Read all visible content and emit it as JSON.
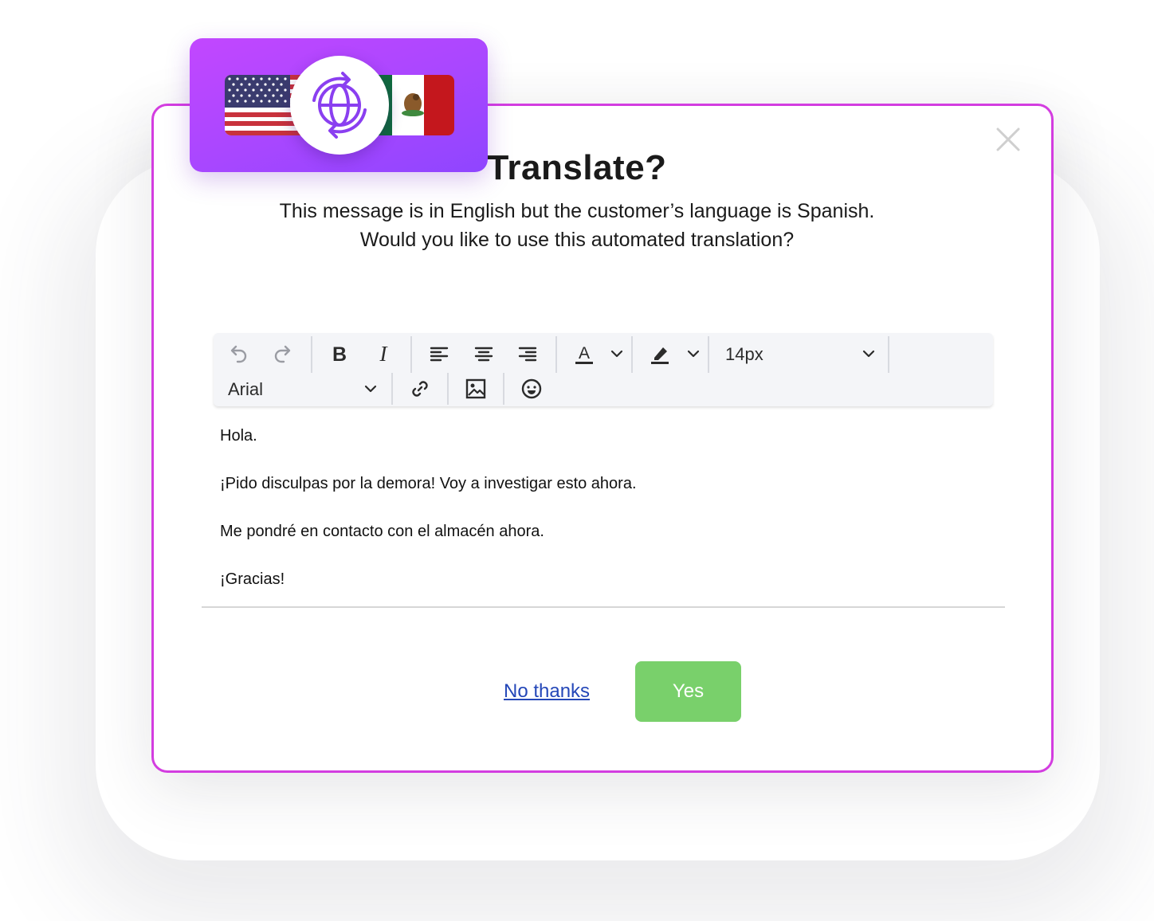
{
  "dialog": {
    "title": "Translate?",
    "message_line1": "This message is in English but the customer’s language is Spanish.",
    "message_line2": "Would you like to use this automated translation?",
    "close_icon": "close-icon",
    "accent_border": "#d33de0"
  },
  "badge": {
    "source_flag": "us-flag-icon",
    "target_flag": "mexico-flag-icon",
    "center_icon": "globe-sync-icon",
    "gradient": [
      "#c247ff",
      "#8f45ff"
    ]
  },
  "toolbar": {
    "font_size_value": "14px",
    "font_family_value": "Arial",
    "icons": [
      "undo-icon",
      "redo-icon",
      "bold-icon",
      "italic-icon",
      "align-left-icon",
      "align-center-icon",
      "align-right-icon",
      "text-color-icon",
      "highlight-icon",
      "link-icon",
      "image-icon",
      "emoji-icon"
    ]
  },
  "editor": {
    "lines": [
      "Hola.",
      "¡Pido disculpas por la demora! Voy a investigar esto ahora.",
      "Me pondré en contacto con el almacén ahora.",
      "¡Gracias!"
    ]
  },
  "actions": {
    "decline_label": "No thanks",
    "accept_label": "Yes",
    "accept_color": "#79d06b",
    "decline_color": "#2447b8"
  }
}
